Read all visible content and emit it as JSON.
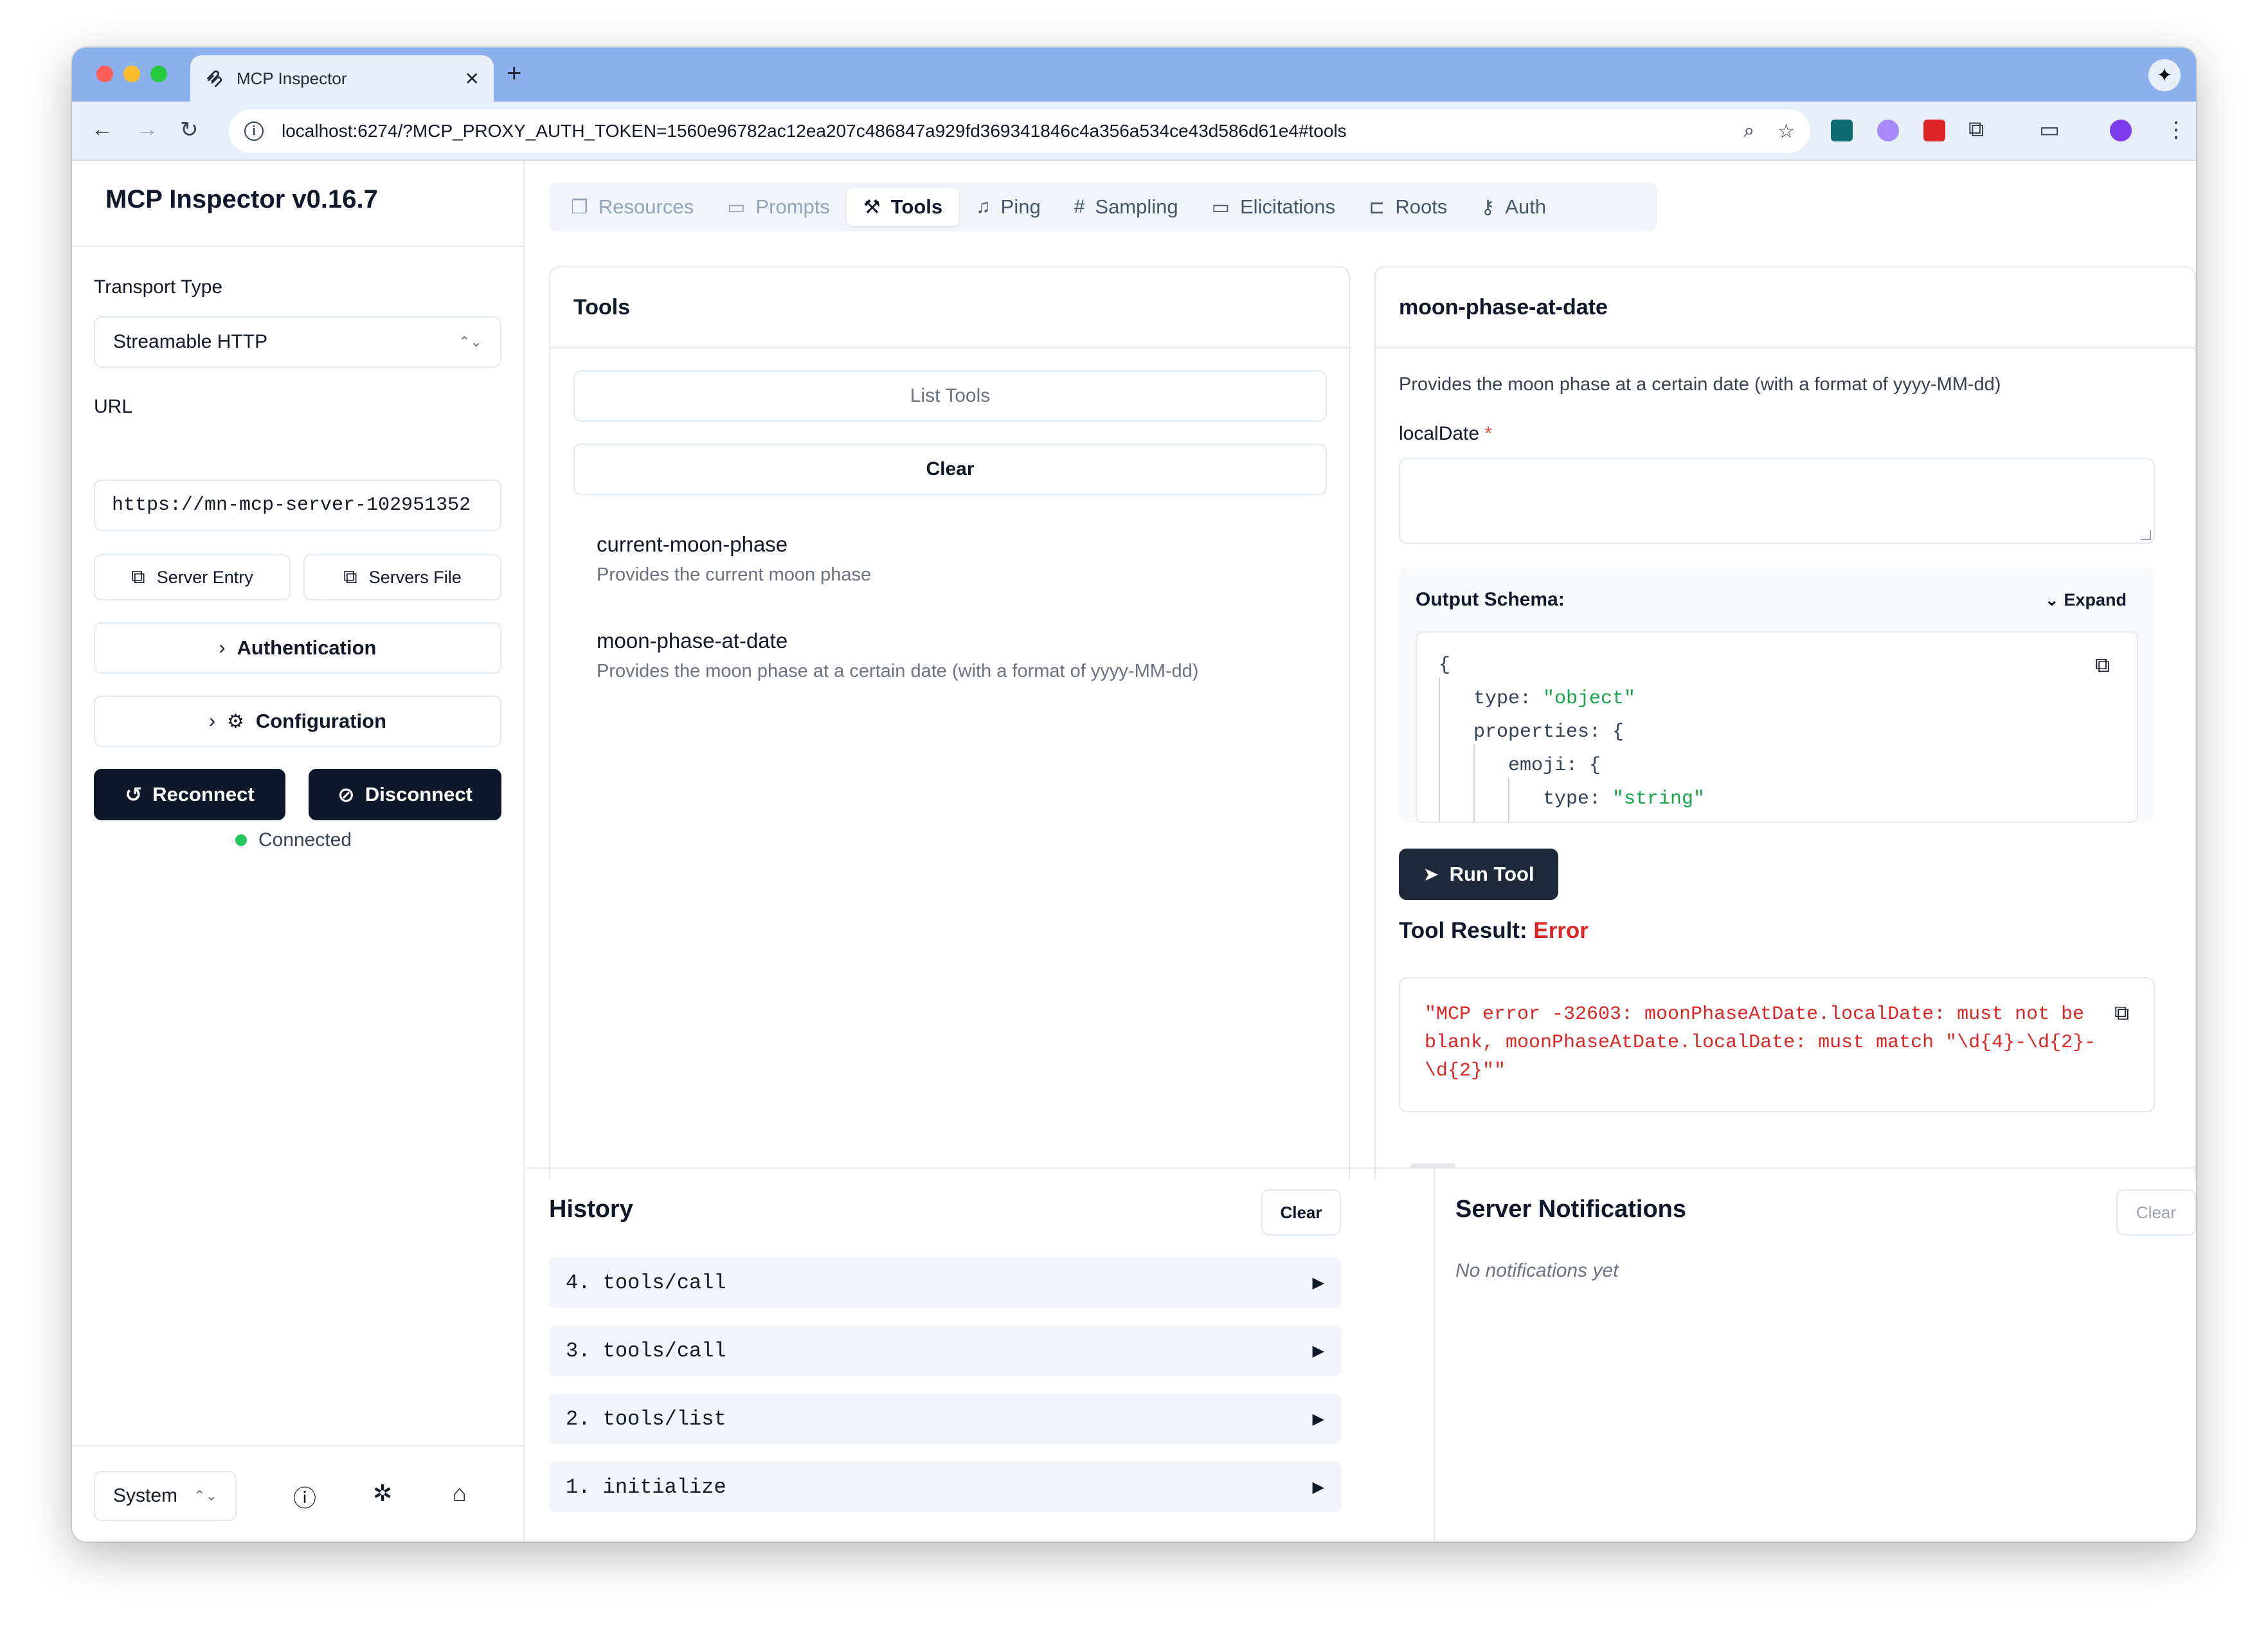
{
  "browser": {
    "tab_title": "MCP Inspector",
    "tab_close": "✕",
    "new_tab": "+",
    "url": "localhost:6274/?MCP_PROXY_AUTH_TOKEN=1560e96782ac12ea207c486847a929fd369341846c4a356a534ce43d586d61e4#tools"
  },
  "sidebar": {
    "title": "MCP Inspector v0.16.7",
    "transport_label": "Transport Type",
    "transport_value": "Streamable HTTP",
    "url_label": "URL",
    "url_value": "https://mn-mcp-server-102951352",
    "server_entry": "Server Entry",
    "servers_file": "Servers File",
    "authentication": "Authentication",
    "configuration": "Configuration",
    "reconnect": "Reconnect",
    "disconnect": "Disconnect",
    "status": "Connected",
    "theme": "System"
  },
  "tabs": [
    {
      "label": "Resources",
      "icon": "resources-icon"
    },
    {
      "label": "Prompts",
      "icon": "prompts-icon"
    },
    {
      "label": "Tools",
      "icon": "tools-icon"
    },
    {
      "label": "Ping",
      "icon": "bell-icon"
    },
    {
      "label": "Sampling",
      "icon": "hash-icon"
    },
    {
      "label": "Elicitations",
      "icon": "message-icon"
    },
    {
      "label": "Roots",
      "icon": "folder-tree-icon"
    },
    {
      "label": "Auth",
      "icon": "key-icon"
    }
  ],
  "tools_panel": {
    "title": "Tools",
    "list_tools": "List Tools",
    "clear": "Clear",
    "items": [
      {
        "name": "current-moon-phase",
        "desc": "Provides the current moon phase"
      },
      {
        "name": "moon-phase-at-date",
        "desc": "Provides the moon phase at a certain date (with a format of yyyy-MM-dd)"
      }
    ]
  },
  "detail": {
    "title": "moon-phase-at-date",
    "description": "Provides the moon phase at a certain date (with a format of yyyy-MM-dd)",
    "field_label": "localDate",
    "field_required": "*",
    "schema_title": "Output Schema:",
    "expand": "Expand",
    "code": {
      "open_brace": "{",
      "type_key": "type:",
      "type_val": "\"object\"",
      "props_key": "properties: {",
      "emoji_key": "emoji: {",
      "inner_type_key": "type:",
      "inner_type_val": "\"string\""
    },
    "run_tool": "Run Tool",
    "result_label": "Tool Result:",
    "result_status": "Error",
    "result_text": "\"MCP error -32603: moonPhaseAtDate.localDate: must not be blank, moonPhaseAtDate.localDate: must match \"\\d{4}-\\d{2}-\\d{2}\"\""
  },
  "history": {
    "title": "History",
    "clear": "Clear",
    "items": [
      "4. tools/call",
      "3. tools/call",
      "2. tools/list",
      "1. initialize"
    ],
    "arrow": "▶"
  },
  "notifications": {
    "title": "Server Notifications",
    "clear": "Clear",
    "empty": "No notifications yet"
  },
  "colors": {
    "accent_dark": "#0f172a",
    "error": "#dc2626",
    "connected": "#22c55e",
    "string_value": "#16a34a"
  }
}
